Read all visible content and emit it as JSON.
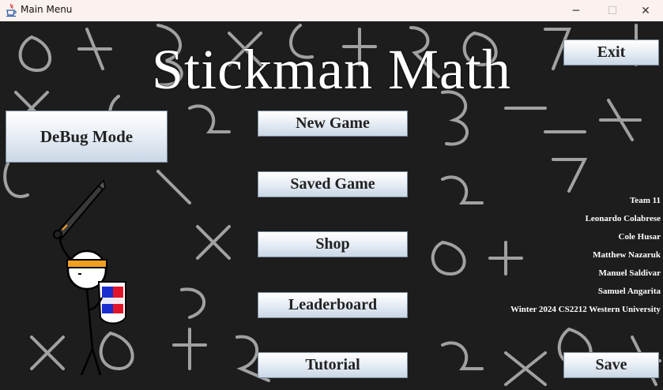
{
  "window": {
    "title": "Main Menu",
    "minimize_glyph": "─",
    "maximize_glyph": "☐",
    "close_glyph": "✕"
  },
  "game_title": "Stickman Math",
  "buttons": {
    "exit": "Exit",
    "debug": "DeBug Mode",
    "new_game": "New Game",
    "saved_game": "Saved Game",
    "shop": "Shop",
    "leaderboard": "Leaderboard",
    "tutorial": "Tutorial",
    "save": "Save"
  },
  "credits": [
    "Team 11",
    "Leonardo Colabrese",
    "Cole Husar",
    "Matthew Nazaruk",
    "Manuel Saldivar",
    "Samuel Angarita",
    "Winter 2024 CS2212 Western University"
  ],
  "colors": {
    "background": "#1d1d1d",
    "chalk": "#d9d9d9",
    "title_text": "#ffffff",
    "headband": "#f0a020",
    "shield_red": "#e0142a",
    "shield_blue": "#1a2ed0"
  }
}
